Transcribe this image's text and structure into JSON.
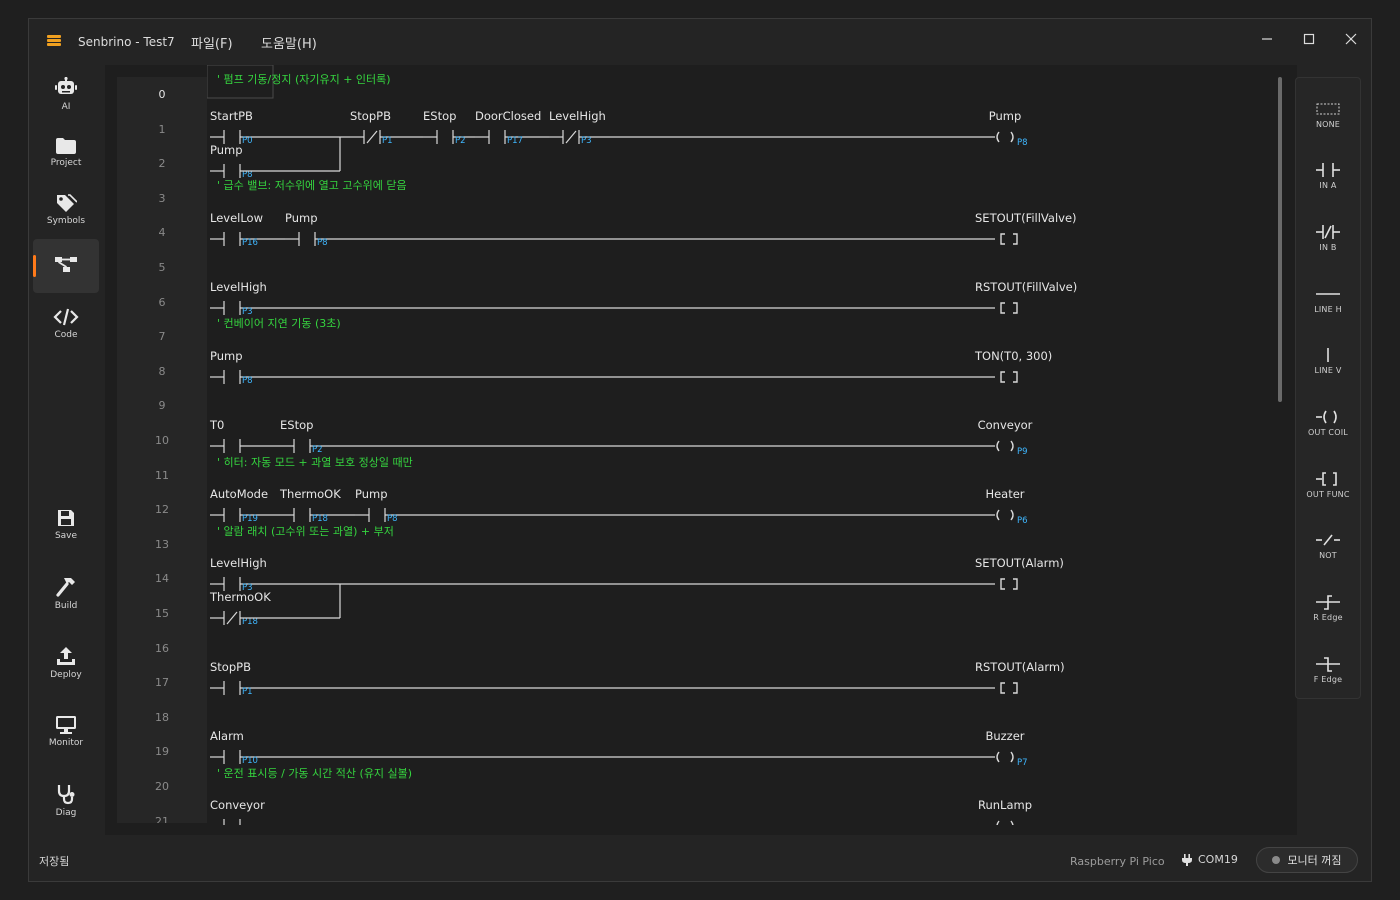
{
  "titlebar": {
    "app_title": "Senbrino - Test7",
    "menus": [
      "파일(F)",
      "도움말(H)"
    ]
  },
  "sidebar": {
    "top_items": [
      {
        "label": "AI",
        "icon": "robot-icon"
      },
      {
        "label": "Project",
        "icon": "folder-icon"
      },
      {
        "label": "Symbols",
        "icon": "tag-icon"
      },
      {
        "label": "",
        "icon": "ladder-diagram-icon",
        "active": true
      },
      {
        "label": "Code",
        "icon": "code-icon"
      }
    ],
    "bottom_items": [
      {
        "label": "Save",
        "icon": "save-icon"
      },
      {
        "label": "Build",
        "icon": "hammer-icon"
      },
      {
        "label": "Deploy",
        "icon": "upload-icon"
      },
      {
        "label": "Monitor",
        "icon": "monitor-icon"
      },
      {
        "label": "Diag",
        "icon": "stethoscope-icon"
      }
    ]
  },
  "editor": {
    "line_numbers": [
      "0",
      "1",
      "2",
      "3",
      "4",
      "5",
      "6",
      "7",
      "8",
      "9",
      "10",
      "11",
      "12",
      "13",
      "14",
      "15",
      "16",
      "17",
      "18",
      "19",
      "20",
      "21"
    ],
    "comments": [
      "' 펌프 기동/정지 (자기유지 + 인터록)",
      "' 급수 밸브: 저수위에 열고 고수위에 닫음",
      "' 컨베이어 지연 기동 (3초)",
      "' 히터: 자동 모드 + 과열 보호 정상일 때만",
      "' 알람 래치 (고수위 또는 과열) + 부저",
      "' 운전 표시등 / 가동 시간 적산 (유지 실볼)"
    ],
    "rungs": [
      {
        "contacts": [
          {
            "name": "StartPB",
            "addr": "P0",
            "nc": false
          },
          {
            "name": "StopPB",
            "addr": "P1",
            "nc": true
          },
          {
            "name": "EStop",
            "addr": "P2",
            "nc": false
          },
          {
            "name": "DoorClosed",
            "addr": "P17",
            "nc": false
          },
          {
            "name": "LevelHigh",
            "addr": "P3",
            "nc": true
          }
        ],
        "branch": [
          {
            "name": "Pump",
            "addr": "P8",
            "nc": false
          }
        ],
        "output": {
          "kind": "coil",
          "name": "Pump",
          "addr": "P8"
        }
      },
      {
        "contacts": [
          {
            "name": "LevelLow",
            "addr": "P16",
            "nc": false
          },
          {
            "name": "Pump",
            "addr": "P8",
            "nc": false
          }
        ],
        "output": {
          "kind": "func",
          "name": "SETOUT(FillValve)",
          "addr": ""
        }
      },
      {
        "contacts": [
          {
            "name": "LevelHigh",
            "addr": "P3",
            "nc": false
          }
        ],
        "output": {
          "kind": "func",
          "name": "RSTOUT(FillValve)",
          "addr": ""
        }
      },
      {
        "contacts": [
          {
            "name": "Pump",
            "addr": "P8",
            "nc": false
          }
        ],
        "output": {
          "kind": "func",
          "name": "TON(T0, 300)",
          "addr": ""
        }
      },
      {
        "contacts": [
          {
            "name": "T0",
            "addr": "",
            "nc": false
          },
          {
            "name": "EStop",
            "addr": "P2",
            "nc": false
          }
        ],
        "output": {
          "kind": "coil",
          "name": "Conveyor",
          "addr": "P9"
        }
      },
      {
        "contacts": [
          {
            "name": "AutoMode",
            "addr": "P19",
            "nc": false
          },
          {
            "name": "ThermoOK",
            "addr": "P18",
            "nc": false
          },
          {
            "name": "Pump",
            "addr": "P8",
            "nc": false
          }
        ],
        "output": {
          "kind": "coil",
          "name": "Heater",
          "addr": "P6"
        }
      },
      {
        "contacts": [
          {
            "name": "LevelHigh",
            "addr": "P3",
            "nc": false
          }
        ],
        "branch": [
          {
            "name": "ThermoOK",
            "addr": "P18",
            "nc": true
          }
        ],
        "output": {
          "kind": "func",
          "name": "SETOUT(Alarm)",
          "addr": ""
        }
      },
      {
        "contacts": [
          {
            "name": "StopPB",
            "addr": "P1",
            "nc": false
          }
        ],
        "output": {
          "kind": "func",
          "name": "RSTOUT(Alarm)",
          "addr": ""
        }
      },
      {
        "contacts": [
          {
            "name": "Alarm",
            "addr": "P10",
            "nc": false
          }
        ],
        "output": {
          "kind": "coil",
          "name": "Buzzer",
          "addr": "P7"
        }
      },
      {
        "contacts": [
          {
            "name": "Conveyor",
            "addr": "",
            "nc": false
          }
        ],
        "output": {
          "kind": "coil",
          "name": "RunLamp",
          "addr": ""
        }
      }
    ]
  },
  "palette": [
    {
      "label": "NONE",
      "icon": "none-icon"
    },
    {
      "label": "IN A",
      "icon": "contact-no-icon"
    },
    {
      "label": "IN B",
      "icon": "contact-nc-icon"
    },
    {
      "label": "LINE H",
      "icon": "line-horizontal-icon"
    },
    {
      "label": "LINE V",
      "icon": "line-vertical-icon"
    },
    {
      "label": "OUT COIL",
      "icon": "coil-icon"
    },
    {
      "label": "OUT FUNC",
      "icon": "function-block-icon"
    },
    {
      "label": "NOT",
      "icon": "not-icon"
    },
    {
      "label": "R Edge",
      "icon": "rising-edge-icon"
    },
    {
      "label": "F Edge",
      "icon": "falling-edge-icon"
    }
  ],
  "statusbar": {
    "status_text": "저장됨",
    "board": "Raspberry Pi Pico",
    "port": "COM19",
    "monitor_toggle": "모니터 꺼짐"
  },
  "colors": {
    "comment": "#35d43f",
    "address": "#3fb7ff",
    "accent": "#ff7a1a",
    "wire": "#d8d8d8"
  }
}
